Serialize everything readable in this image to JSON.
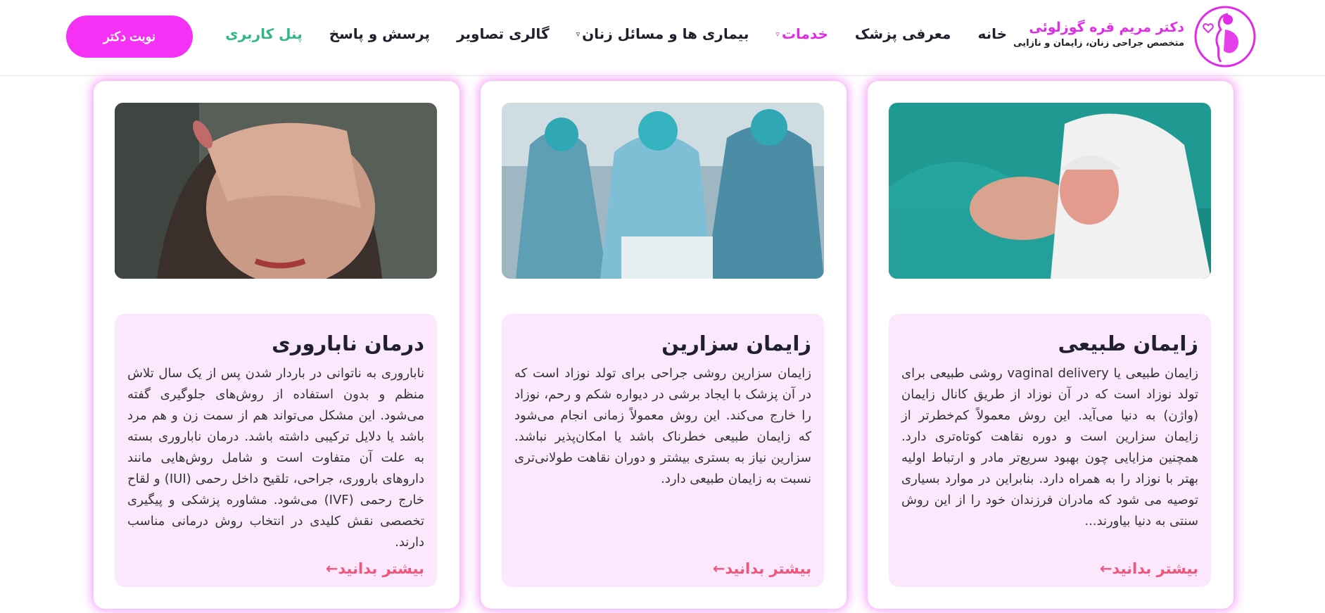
{
  "brand": {
    "name": "دکتر مریم قره گوزلوئی",
    "subtitle": "متخصص جراحی زنان، زایمان و نازایی"
  },
  "nav": {
    "items": [
      {
        "label": "خانه"
      },
      {
        "label": "معرفی پزشک"
      },
      {
        "label": "خدمات"
      },
      {
        "label": "بیماری ها و مسائل زنان"
      },
      {
        "label": "گالری تصاویر"
      },
      {
        "label": "پرسش و پاسخ"
      },
      {
        "label": "پنل کاربری"
      }
    ]
  },
  "cta": {
    "label": "نوبت دکتر"
  },
  "cards": [
    {
      "title": "زایمان طبیعی",
      "text": "زایمان طبیعی یا vaginal delivery روشی طبیعی برای تولد نوزاد است که در آن نوزاد از طریق کانال زایمان (واژن) به دنیا می‌آید. این روش معمولاً کم‌خطرتر از زایمان سزارین است و دوره نقاهت کوتاه‌تری دارد. همچنین مزایایی چون بهبود سریع‌تر مادر و ارتباط اولیه بهتر با نوزاد را به همراه دارد. بنابراین در موارد بسیاری توصیه می شود که مادران فرزندان خود را از این روش سنتی به دنیا بیاورند...",
      "more": "بیشتر بدانید←"
    },
    {
      "title": "زایمان سزارین",
      "text": "زایمان سزارین روشی جراحی برای تولد نوزاد است که در آن پزشک با ایجاد برشی در دیواره شکم و رحم، نوزاد را خارج می‌کند. این روش معمولاً زمانی انجام می‌شود که زایمان طبیعی خطرناک باشد یا امکان‌پذیر نباشد. سزارین نیاز به بستری بیشتر و دوران نقاهت طولانی‌تری نسبت به زایمان طبیعی دارد.",
      "more": "بیشتر بدانید←"
    },
    {
      "title": "درمان ناباروری",
      "text": "ناباروری به ناتوانی در باردار شدن پس از یک سال تلاش منظم و بدون استفاده از روش‌های جلوگیری گفته می‌شود. این مشکل می‌تواند هم از سمت زن و هم مرد باشد یا دلایل ترکیبی داشته باشد. درمان ناباروری بسته به علت آن متفاوت است و شامل روش‌هایی مانند داروهای باروری، جراحی، تلقیح داخل رحمی (IUI) و لقاح خارج رحمی (IVF) می‌شود. مشاوره پزشکی و پیگیری تخصصی نقش کلیدی در انتخاب روش درمانی مناسب دارند.",
      "more": "بیشتر بدانید←"
    }
  ],
  "colors": {
    "accent": "#e22be8",
    "cta": "#f531f5",
    "panel": "#31b889",
    "more": "#f2547a",
    "card_body": "#fce8fc"
  }
}
